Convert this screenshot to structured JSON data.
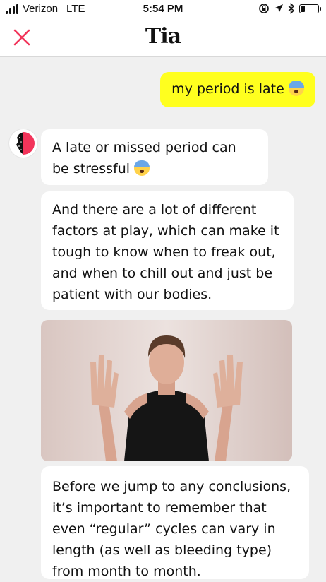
{
  "status_bar": {
    "carrier": "Verizon",
    "network": "LTE",
    "time": "5:54 PM",
    "signal_bars": 4,
    "battery_level": 0.25
  },
  "header": {
    "logo_text": "Tia",
    "close_icon": "close-icon",
    "accent_color": "#f2345a"
  },
  "chat": {
    "user_message": {
      "text": "my period is late",
      "emoji": "anxious-face"
    },
    "bot_messages": [
      {
        "text": "A late or missed period can be stressful",
        "emoji": "anxious-face"
      },
      {
        "text": "And there are a lot of different factors at play, which can make it tough to know when to freak out, and when to chill out and just be patient with our bodies."
      },
      {
        "text": "Before we jump to any conclusions, it’s important to remember that even “regular” cycles can vary in length (as well as bleeding type) from month to month."
      }
    ],
    "video": {
      "subject": "woman-gesturing-video"
    }
  },
  "colors": {
    "user_bubble": "#ffff1f",
    "bot_bubble": "#ffffff",
    "background": "#f0f0f0"
  }
}
